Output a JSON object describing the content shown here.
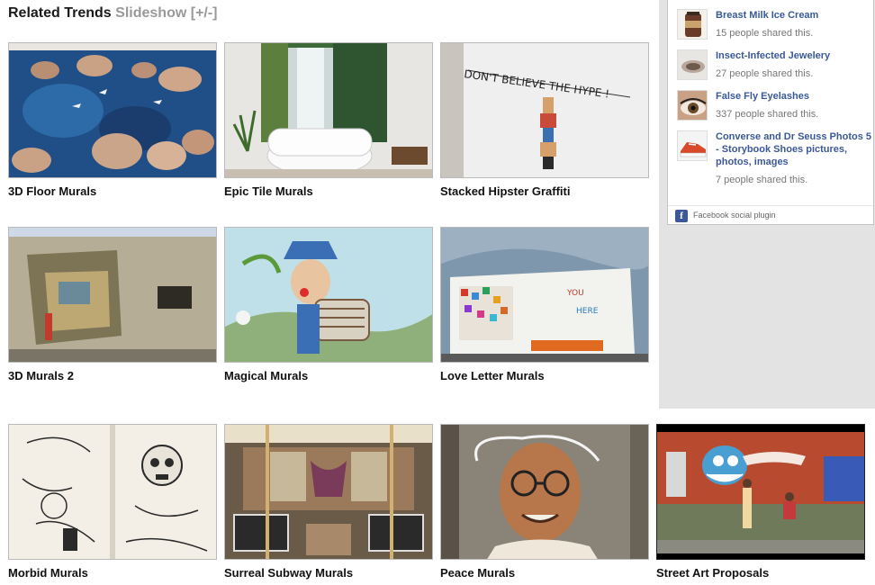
{
  "header": {
    "title": "Related Trends",
    "slideshow_link": "Slideshow",
    "toggle": "[+/-]"
  },
  "facebook": {
    "items": [
      {
        "title": "Breast Milk Ice Cream",
        "count": "15 people shared this.",
        "icon": "ice-cream-thumbnail"
      },
      {
        "title": "Insect-Infected Jewelery",
        "count": "27 people shared this.",
        "icon": "jewelry-thumbnail"
      },
      {
        "title": "False Fly Eyelashes",
        "count": "337 people shared this.",
        "icon": "eye-thumbnail"
      },
      {
        "title": "Converse and Dr Seuss Photos 5 - Storybook Shoes pictures, photos, images",
        "count": "7 people shared this.",
        "icon": "shoe-thumbnail"
      }
    ],
    "footer": "Facebook social plugin",
    "logo_letter": "f"
  },
  "tiles": [
    {
      "caption": "3D Floor Murals",
      "icon": "floor-mural-image"
    },
    {
      "caption": "Epic Tile Murals",
      "icon": "bathroom-waterfall-image"
    },
    {
      "caption": "Stacked Hipster Graffiti",
      "icon": "graffiti-wall-image"
    },
    {
      "caption": "3D Murals 2",
      "icon": "building-mural-image"
    },
    {
      "caption": "Magical Murals",
      "icon": "clown-accordion-image"
    },
    {
      "caption": "Love Letter Murals",
      "icon": "letter-wall-image"
    },
    {
      "caption": "Morbid Murals",
      "icon": "skull-mural-image"
    },
    {
      "caption": "Surreal Subway Murals",
      "icon": "subway-car-image"
    },
    {
      "caption": "Peace Murals",
      "icon": "gandhi-mural-image"
    },
    {
      "caption": "Street Art Proposals",
      "icon": "street-proposal-image"
    }
  ],
  "colors": {
    "link_blue": "#3b5998",
    "muted_gray": "#999999",
    "sidebar_bg": "#e3e3e3"
  }
}
